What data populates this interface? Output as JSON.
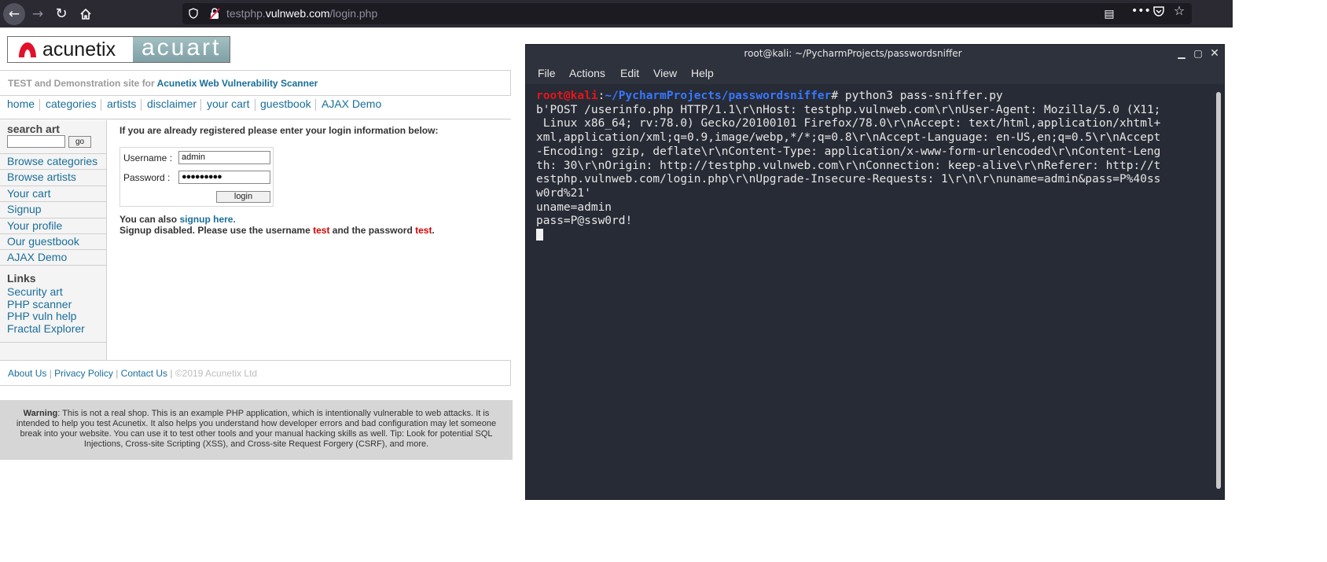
{
  "browser": {
    "url_prefix": "testphp.",
    "url_host": "vulnweb.com",
    "url_path": "/login.php",
    "icons": [
      "arrow-left-icon",
      "arrow-right-icon",
      "reload-icon",
      "home-icon",
      "shield-icon",
      "insecure-lock-icon",
      "reader-view-icon",
      "more-icon",
      "pocket-icon",
      "star-icon"
    ]
  },
  "site": {
    "logo_left": "acunetix",
    "logo_right": "acuart",
    "tagline_prefix": "TEST and Demonstration site for ",
    "tagline_link": "Acunetix Web Vulnerability Scanner",
    "nav": [
      "home",
      "categories",
      "artists",
      "disclaimer",
      "your cart",
      "guestbook",
      "AJAX Demo"
    ],
    "search_title": "search art",
    "search_button": "go",
    "sidebar_links": [
      "Browse categories",
      "Browse artists",
      "Your cart",
      "Signup",
      "Your profile",
      "Our guestbook",
      "AJAX Demo"
    ],
    "links_title": "Links",
    "links": [
      "Security art",
      "PHP scanner",
      "PHP vuln help",
      "Fractal Explorer"
    ],
    "login_heading": "If you are already registered please enter your login information below:",
    "username_label": "Username :",
    "username_value": "admin",
    "password_label": "Password :",
    "password_value": "●●●●●●●●●",
    "login_button": "login",
    "signup_prefix": "You can also ",
    "signup_link": "signup here.",
    "signup_disabled_a": "Signup disabled. Please use the username ",
    "signup_user": "test",
    "signup_disabled_b": " and the password ",
    "signup_pass": "test",
    "signup_disabled_c": ".",
    "footer_links": [
      "About Us",
      "Privacy Policy",
      "Contact Us"
    ],
    "footer_sep": "|",
    "footer_copy": "©2019 Acunetix Ltd",
    "warning_label": "Warning",
    "warning_text": ": This is not a real shop. This is an example PHP application, which is intentionally vulnerable to web attacks. It is intended to help you test Acunetix. It also helps you understand how developer errors and bad configuration may let someone break into your website. You can use it to test other tools and your manual hacking skills as well. Tip: Look for potential SQL Injections, Cross-site Scripting (XSS), and Cross-site Request Forgery (CSRF), and more."
  },
  "terminal": {
    "title": "root@kali: ~/PycharmProjects/passwordsniffer",
    "menu": [
      "File",
      "Actions",
      "Edit",
      "View",
      "Help"
    ],
    "prompt_user": "root@kali",
    "prompt_colon": ":",
    "prompt_path": "~/PycharmProjects/passwordsniffer",
    "prompt_suffix": "# python3 pass-sniffer.py",
    "output_lines": [
      "b'POST /userinfo.php HTTP/1.1\\r\\nHost: testphp.vulnweb.com\\r\\nUser-Agent: Mozilla/5.0 (X11;",
      " Linux x86_64; rv:78.0) Gecko/20100101 Firefox/78.0\\r\\nAccept: text/html,application/xhtml+",
      "xml,application/xml;q=0.9,image/webp,*/*;q=0.8\\r\\nAccept-Language: en-US,en;q=0.5\\r\\nAccept",
      "-Encoding: gzip, deflate\\r\\nContent-Type: application/x-www-form-urlencoded\\r\\nContent-Leng",
      "th: 30\\r\\nOrigin: http://testphp.vulnweb.com\\r\\nConnection: keep-alive\\r\\nReferer: http://t",
      "estphp.vulnweb.com/login.php\\r\\nUpgrade-Insecure-Requests: 1\\r\\n\\r\\nuname=admin&pass=P%40ss",
      "w0rd%21'",
      "uname=admin",
      "pass=P@ssw0rd!"
    ]
  },
  "colors": {
    "browser_toolbar": "#2b2a33",
    "terminal_bg": "#272b35",
    "prompt_user": "#e5151c",
    "prompt_path": "#3877ff",
    "link_blue": "#1a6e99",
    "red_text": "#d40000"
  }
}
